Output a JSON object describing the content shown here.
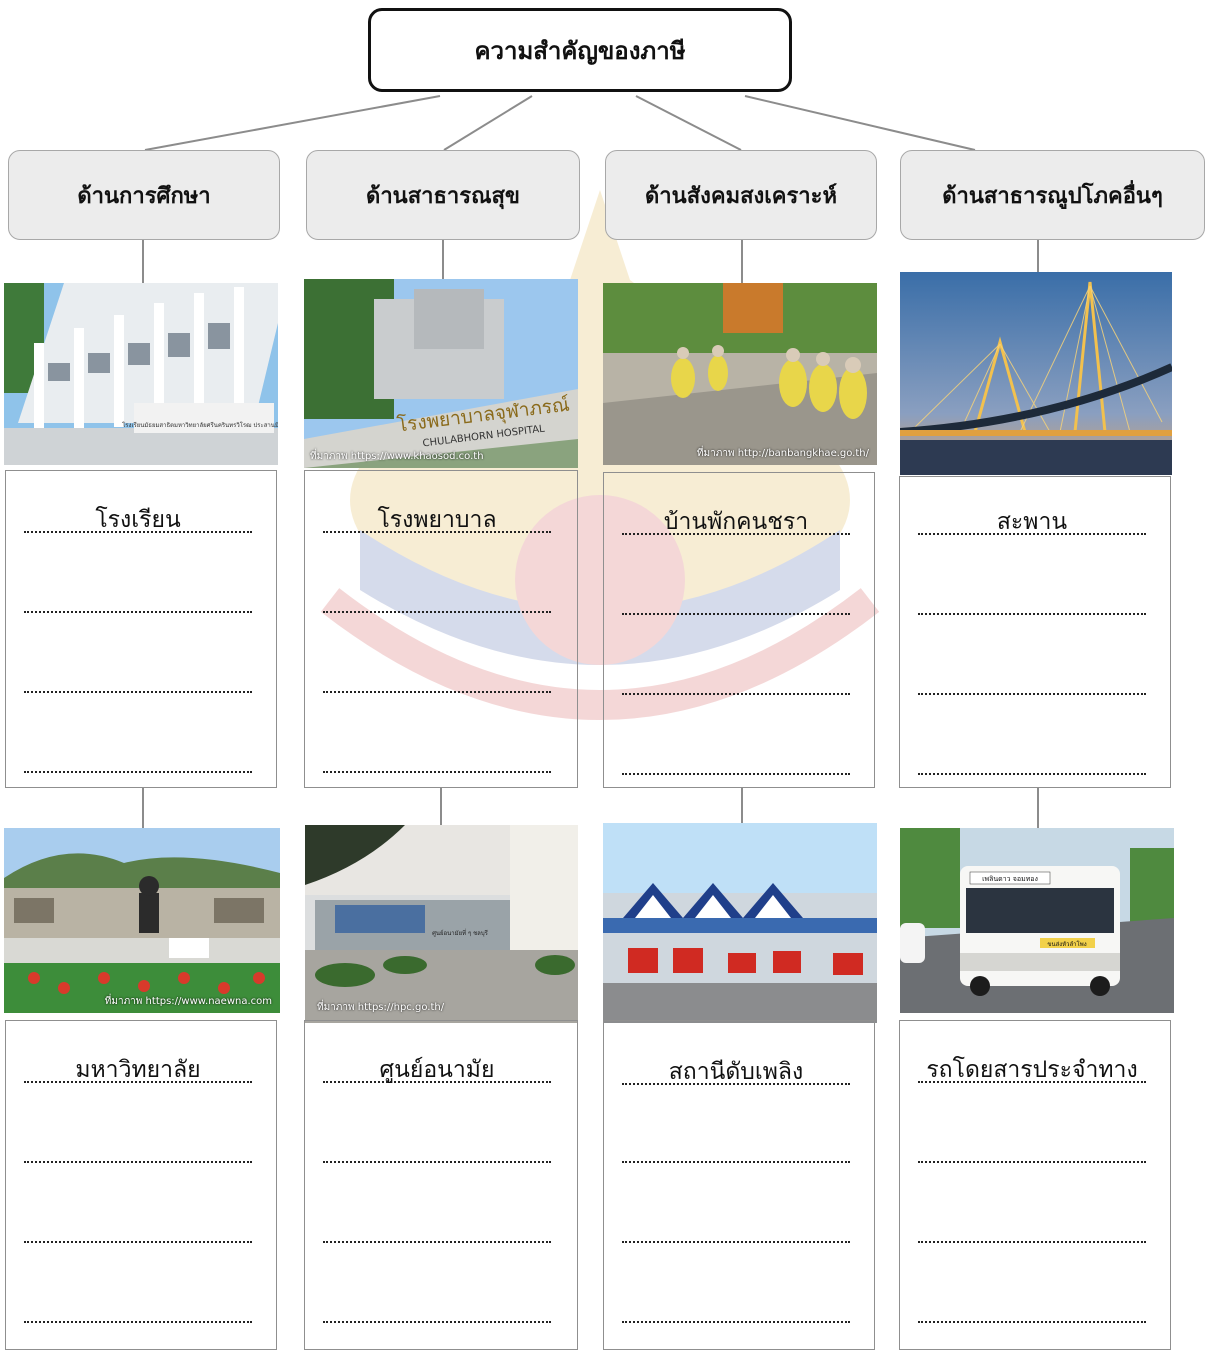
{
  "diagram": {
    "title": "ความสำคัญของภาษี",
    "categories": [
      {
        "label": "ด้านการศึกษา",
        "examples": [
          "โรงเรียน",
          "มหาวิทยาลัย"
        ]
      },
      {
        "label": "ด้านสาธารณสุข",
        "examples": [
          "โรงพยาบาล",
          "ศูนย์อนามัย"
        ]
      },
      {
        "label": "ด้านสังคมสงเคราะห์",
        "examples": [
          "บ้านพักคนชรา",
          "สถานีดับเพลิง"
        ]
      },
      {
        "label": "ด้านสาธารณูปโภคอื่นๆ",
        "examples": [
          "สะพาน",
          "รถโดยสารประจำทาง"
        ]
      }
    ]
  },
  "photos": {
    "school_sign": "โรงเรียนมัธยมสาธิตมหาวิทยาลัยศรีนครินทรวิโรฒ ประสานมิตร",
    "hospital_sign": "โรงพยาบาลจุฬาภรณ์",
    "hospital_sign_en": "CHULABHORN HOSPITAL",
    "hospital_credit": "ที่มาภาพ https://www.khaosod.co.th",
    "elderly_credit": "ที่มาภาพ http://banbangkhae.go.th/",
    "university_credit": "ที่มาภาพ https://www.naewna.com",
    "health_center_sign": "ศูนย์อนามัยที่ ๆ ชลบุรี",
    "health_center_credit": "ที่มาภาพ https://hpc.go.th/",
    "bus_sign": "เพลินดาว จอมทอง",
    "bus_route": "ขนส่งหัวลำโพง"
  },
  "colors": {
    "category_fill": "#ececec",
    "category_border": "#a8a8a8",
    "connector": "#8c8c8c",
    "card_border": "#8f8f8f"
  }
}
